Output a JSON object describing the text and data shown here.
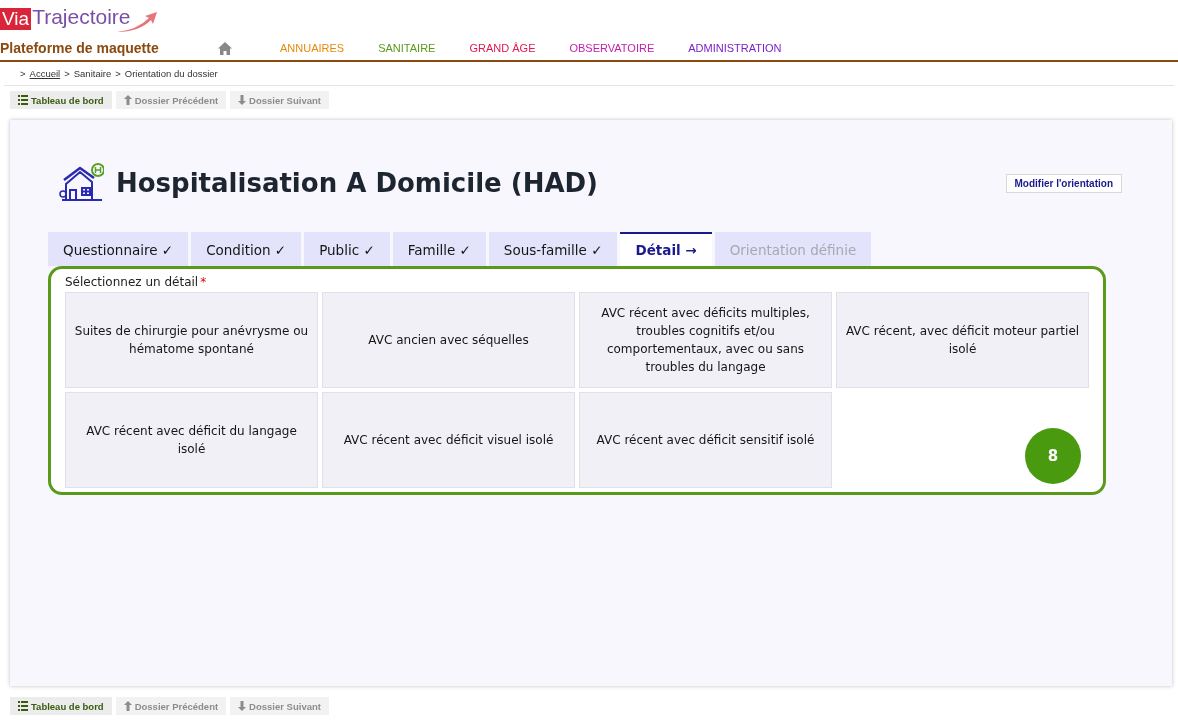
{
  "header": {
    "logo_part_1": "Via",
    "logo_part_2": "Trajectoire",
    "platform": "Plateforme de maquette"
  },
  "nav": [
    {
      "label": "ANNUAIRES",
      "color": "#e8890c"
    },
    {
      "label": "SANITAIRE",
      "color": "#5a9a1a"
    },
    {
      "label": "GRAND ÂGE",
      "color": "#e0194f"
    },
    {
      "label": "OBSERVATOIRE",
      "color": "#c21fa8"
    },
    {
      "label": "ADMINISTRATION",
      "color": "#7a1fc9"
    }
  ],
  "breadcrumb_separator": ">",
  "breadcrumb": [
    {
      "label": "Accueil",
      "link": true
    },
    {
      "label": "Sanitaire",
      "link": false
    },
    {
      "label": "Orientation du dossier",
      "link": false
    }
  ],
  "toolbar_top": [
    {
      "kind": "list",
      "label": "Tableau de bord",
      "disabled": false
    },
    {
      "kind": "up",
      "label": "Dossier Précédent",
      "disabled": true
    },
    {
      "kind": "down",
      "label": "Dossier Suivant",
      "disabled": true
    }
  ],
  "title": "Hospitalisation A Domicile (HAD)",
  "modify_button": "Modifier l'orientation",
  "tabs": [
    {
      "label": "Questionnaire ✓",
      "selected": false,
      "disabled": false
    },
    {
      "label": "Condition ✓",
      "selected": false,
      "disabled": false
    },
    {
      "label": "Public ✓",
      "selected": false,
      "disabled": false
    },
    {
      "label": "Famille ✓",
      "selected": false,
      "disabled": false
    },
    {
      "label": "Sous-famille ✓",
      "selected": false,
      "disabled": false
    },
    {
      "label": "Détail →",
      "selected": true,
      "disabled": false
    },
    {
      "label": "Orientation définie",
      "selected": false,
      "disabled": true
    }
  ],
  "detail_prompt": {
    "label": "Sélectionnez un détail",
    "required": "*"
  },
  "options": [
    "Suites de chirurgie pour anévrysme ou hématome spontané",
    "AVC ancien avec séquelles",
    "AVC récent avec déficits multiples, troubles cognitifs et/ou comportementaux, avec ou sans troubles du langage",
    "AVC récent, avec déficit moteur partiel isolé",
    "AVC récent avec déficit du langage isolé",
    "AVC récent avec déficit visuel isolé",
    "AVC récent avec déficit sensitif isolé"
  ],
  "annotation_badge": "8",
  "toolbar_bottom": [
    {
      "kind": "list",
      "label": "Tableau de bord",
      "disabled": false
    },
    {
      "kind": "up",
      "label": "Dossier Précédent",
      "disabled": true
    },
    {
      "kind": "down",
      "label": "Dossier Suivant",
      "disabled": true
    }
  ]
}
